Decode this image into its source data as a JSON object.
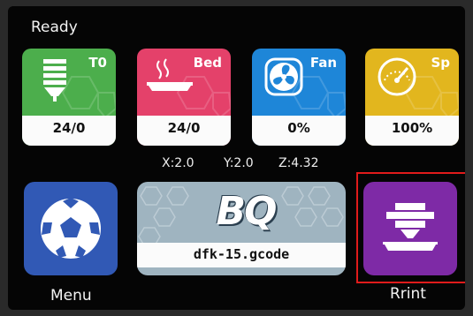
{
  "status": "Ready",
  "tiles": [
    {
      "label": "T0",
      "value": "24/0",
      "color": "#4cae4c",
      "icon": "nozzle-icon"
    },
    {
      "label": "Bed",
      "value": "24/0",
      "color": "#e4416a",
      "icon": "heated-bed-icon"
    },
    {
      "label": "Fan",
      "value": "0%",
      "color": "#1e86d8",
      "icon": "fan-icon"
    },
    {
      "label": "Sp",
      "value": "100%",
      "color": "#e2b61e",
      "icon": "speedometer-icon"
    }
  ],
  "coordinates": {
    "x": "X:2.0",
    "y": "Y:2.0",
    "z": "Z:4.32"
  },
  "menu": {
    "label": "Menu",
    "color": "#3159b5",
    "icon": "soccer-ball-icon"
  },
  "file": {
    "name": "dfk-15.gcode",
    "logo_text": "BQ",
    "background": "#9fb4c0"
  },
  "print": {
    "label": "Rrint",
    "color": "#7e2aa6",
    "icon": "printer-extruder-icon",
    "highlight": "#e01b1b"
  }
}
